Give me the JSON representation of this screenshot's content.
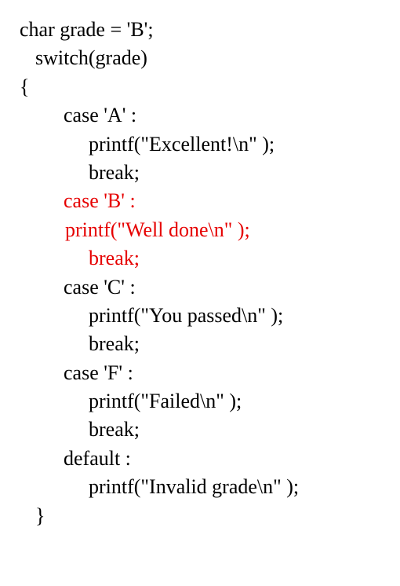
{
  "code": {
    "line1": "char grade = 'B';",
    "line2": "switch(grade)",
    "line3": "{",
    "line4": "case 'A' :",
    "line5": "printf(\"Excellent!\\n\" );",
    "line6": "break;",
    "line7": "case 'B' :",
    "line8": "printf(\"Well done\\n\" );",
    "line9": "break;",
    "line10": "case 'C' :",
    "line11": "printf(\"You passed\\n\" );",
    "line12": "break;",
    "line13": "case 'F' :",
    "line14": "printf(\"Failed\\n\" );",
    "line15": "break;",
    "line16": "default :",
    "line17": "printf(\"Invalid grade\\n\" );",
    "line18": "}"
  }
}
